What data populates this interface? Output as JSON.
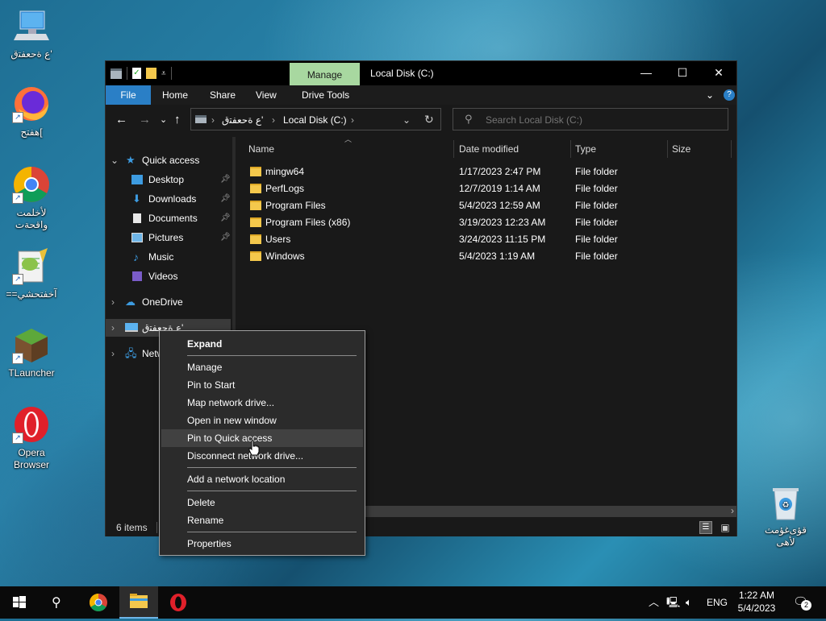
{
  "desktop": {
    "icons": [
      {
        "label": "ﻉ ﺓﺣﻌﻔﺘﻕ'"
      },
      {
        "label": "ﻫﻔﺘﺢ["
      },
      {
        "label": "ﻷﺧﻠﻤﺖ ﻭﺍﻗﺤﺔﺕ"
      },
      {
        "label": "==ﺁﺧﻔﺘﺤﺸﻲ"
      },
      {
        "label": "TLauncher"
      },
      {
        "label": "Opera Browser"
      },
      {
        "label": "ﻗﺆﻯﻏﺆﻣﺚ ﻷﻫﻰ"
      }
    ]
  },
  "window": {
    "title": "Local Disk (C:)",
    "manage_tab": "Manage",
    "ribbon_tabs": [
      "File",
      "Home",
      "Share",
      "View",
      "Drive Tools"
    ],
    "address": {
      "crumb1": "ﻉ ﺓﺣﻌﻔﺘﻕ'",
      "crumb2": "Local Disk (C:)"
    },
    "search_placeholder": "Search Local Disk (C:)",
    "nav": {
      "quick_access": "Quick access",
      "desktop": "Desktop",
      "downloads": "Downloads",
      "documents": "Documents",
      "pictures": "Pictures",
      "music": "Music",
      "videos": "Videos",
      "onedrive": "OneDrive",
      "this_pc": "ﻉ ﺓﺣﻌﻔﺘﻕ'",
      "network": "Netw"
    },
    "columns": {
      "name": "Name",
      "date": "Date modified",
      "type": "Type",
      "size": "Size"
    },
    "files": [
      {
        "name": "mingw64",
        "date": "1/17/2023 2:47 PM",
        "type": "File folder"
      },
      {
        "name": "PerfLogs",
        "date": "12/7/2019 1:14 AM",
        "type": "File folder"
      },
      {
        "name": "Program Files",
        "date": "5/4/2023 12:59 AM",
        "type": "File folder"
      },
      {
        "name": "Program Files (x86)",
        "date": "3/19/2023 12:23 AM",
        "type": "File folder"
      },
      {
        "name": "Users",
        "date": "3/24/2023 11:15 PM",
        "type": "File folder"
      },
      {
        "name": "Windows",
        "date": "5/4/2023 1:19 AM",
        "type": "File folder"
      }
    ],
    "status": "6 items"
  },
  "context_menu": {
    "items": {
      "expand": "Expand",
      "manage": "Manage",
      "pin_start": "Pin to Start",
      "map_drive": "Map network drive...",
      "open_new_window": "Open in new window",
      "pin_quick": "Pin to Quick access",
      "disconnect": "Disconnect network drive...",
      "add_location": "Add a network location",
      "delete": "Delete",
      "rename": "Rename",
      "properties": "Properties"
    }
  },
  "taskbar": {
    "language": "ENG",
    "time": "1:22 AM",
    "date": "5/4/2023",
    "notification_count": "2"
  },
  "colors": {
    "accent": "#2a7fc6",
    "manage_tab": "#a8d8a0",
    "folder": "#f4c84c"
  }
}
